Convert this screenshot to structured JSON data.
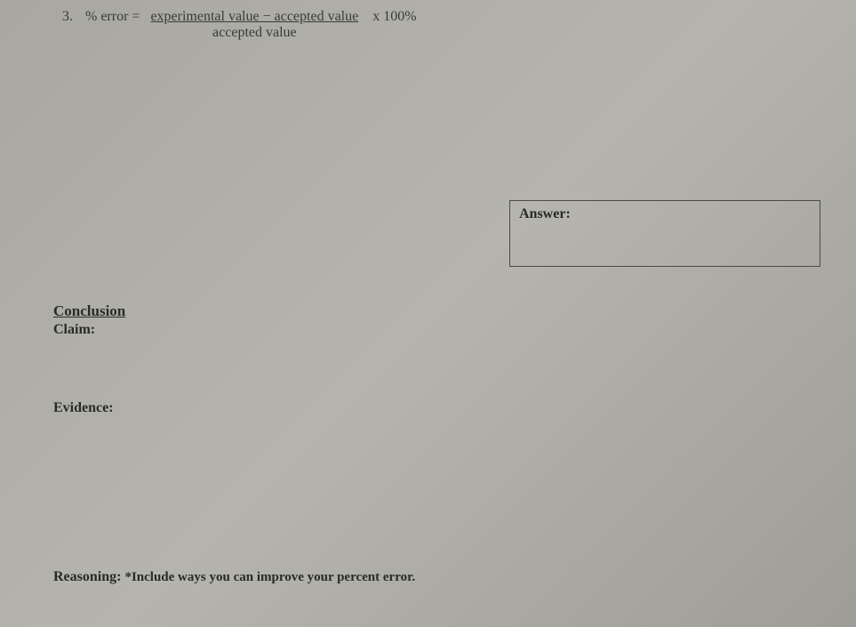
{
  "question": {
    "number": "3.",
    "formula_label": "% error =",
    "fraction_top": "experimental value − accepted value",
    "fraction_bottom": "accepted value",
    "times_text": "x 100%"
  },
  "answer_box": {
    "label": "Answer:"
  },
  "conclusion": {
    "heading": "Conclusion",
    "claim_label": "Claim:"
  },
  "evidence": {
    "label": "Evidence:"
  },
  "reasoning": {
    "label": "Reasoning:",
    "note": "*Include ways you can improve your percent error."
  }
}
